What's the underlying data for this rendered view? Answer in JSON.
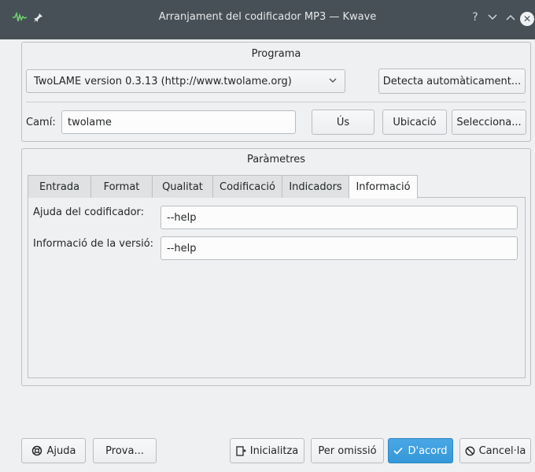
{
  "window": {
    "title": "Arranjament del codificador MP3 — Kwave",
    "help_glyph": "?",
    "minimize_glyph": "⌄",
    "maximize_glyph": "⌃",
    "close_glyph": "✕"
  },
  "programa": {
    "group_title": "Programa",
    "encoder_selected": "TwoLAME version 0.3.13 (http://www.twolame.org)",
    "detect_button": "Detecta automàticament...",
    "path_label": "Camí:",
    "path_value": "twolame",
    "use_button": "Ús",
    "location_button": "Ubicació",
    "select_button": "Selecciona..."
  },
  "parametres": {
    "group_title": "Paràmetres",
    "tabs": [
      {
        "label": "Entrada"
      },
      {
        "label": "Format"
      },
      {
        "label": "Qualitat"
      },
      {
        "label": "Codificació"
      },
      {
        "label": "Indicadors"
      },
      {
        "label": "Informació",
        "active": true
      }
    ],
    "help_label": "Ajuda del codificador:",
    "help_value": "--help",
    "version_label": "Informació de la versió:",
    "version_value": "--help"
  },
  "footer": {
    "help_button": "Ajuda",
    "test_button": "Prova...",
    "reset_button": "Inicialitza",
    "defaults_button": "Per omissió",
    "ok_button": "D'acord",
    "cancel_button": "Cancel·la"
  },
  "colors": {
    "titlebar": "#475057",
    "accent": "#3598d8",
    "background": "#eff0f1"
  }
}
